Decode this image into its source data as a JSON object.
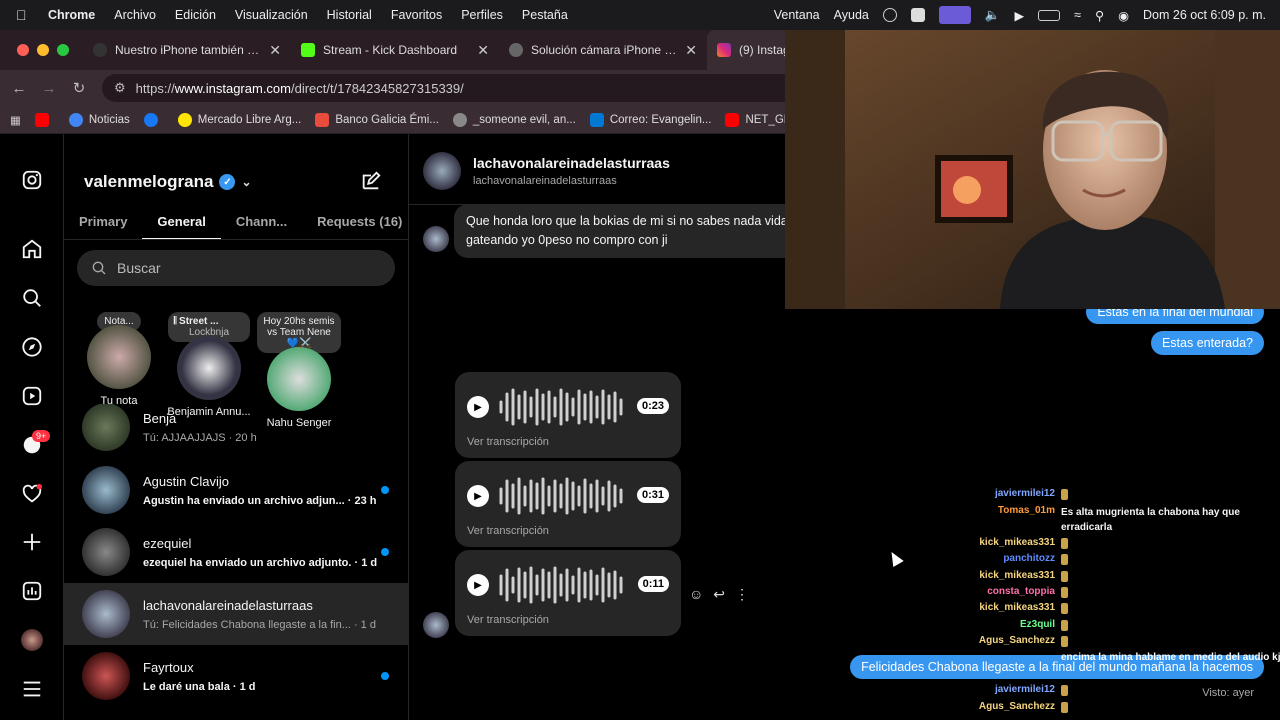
{
  "menubar": {
    "app": "Chrome",
    "items": [
      "Archivo",
      "Edición",
      "Visualización",
      "Historial",
      "Favoritos",
      "Perfiles",
      "Pestaña"
    ],
    "right_items": [
      "Ventana",
      "Ayuda"
    ],
    "datetime": "Dom 26 oct  6:09 p. m."
  },
  "tabs": [
    {
      "title": "Nuestro iPhone también será",
      "color": "#333333"
    },
    {
      "title": "Stream - Kick Dashboard",
      "color": "#53fc18"
    },
    {
      "title": "Solución cámara iPhone Mac",
      "color": "#555555"
    },
    {
      "title": "(9) Instagram",
      "color": "#e1306c"
    }
  ],
  "address": {
    "prefix": "https://",
    "host": "www.instagram.com",
    "path": "/direct/t/17842345827315339/"
  },
  "bookmarks": [
    {
      "label": "",
      "color": "#ff0000"
    },
    {
      "label": "Noticias",
      "color": "#4285f4"
    },
    {
      "label": "",
      "color": "#1877f2"
    },
    {
      "label": "Mercado Libre Arg...",
      "color": "#ffe600"
    },
    {
      "label": "Banco Galicia Émi...",
      "color": "#e74c3c"
    },
    {
      "label": "_someone evil, an...",
      "color": "#888888"
    },
    {
      "label": "Correo: Evangelin...",
      "color": "#0078d4"
    },
    {
      "label": "NET_GRA",
      "color": "#ff0000"
    }
  ],
  "inbox": {
    "account": "valenmelograna",
    "tabs": [
      "Primary",
      "General",
      "Chann...",
      "Requests (16)"
    ],
    "search_placeholder": "Buscar",
    "notes": [
      {
        "bubble": "Nota...",
        "caption": "Tu nota"
      },
      {
        "bubble": "Street ...",
        "bubble2": "Lockbnja",
        "caption": "Benjamin Annu..."
      },
      {
        "bubble": "Hoy 20hs semis vs Team Nene💙⚔️",
        "caption": "Nahu Senger"
      }
    ],
    "partial_row": {
      "name": "Benja",
      "preview": "Tú: AJJAAJJAJS · 20 h"
    },
    "threads": [
      {
        "name": "Agustin Clavijo",
        "preview": "Agustin ha enviado un archivo adjun... · 23 h",
        "unread": true
      },
      {
        "name": "ezequiel",
        "preview": "ezequiel ha enviado un archivo adjunto. · 1 d",
        "unread": true
      },
      {
        "name": "lachavonalareinadelasturraas",
        "preview": "Tú: Felicidades Chabona llegaste a la fin... · 1 d",
        "unread": false
      },
      {
        "name": "Fayrtoux",
        "preview": "Le daré una bala · 1 d",
        "unread": true
      }
    ],
    "badge": "9+"
  },
  "chat": {
    "name": "lachavonalareinadelasturraas",
    "username": "lachavonalareinadelasturraas",
    "incoming_text": "Que honda loro que la bokias  de mi si no sabes nada vida gato y seguí gateando yo 0peso no compro con ji",
    "voice_notes": [
      {
        "duration": "0:23",
        "transcript": "Ver transcripción"
      },
      {
        "duration": "0:31",
        "transcript": "Ver transcripción"
      },
      {
        "duration": "0:11",
        "transcript": "Ver transcripción"
      }
    ],
    "outgoing": [
      "Estas en la final del mundial",
      "Estas enterada?",
      "Felicidades Chabona llegaste a la final del mundo mañana la hacemos"
    ],
    "seen": "Visto: ayer"
  },
  "kick_chat": [
    {
      "user": "javiermilei12",
      "color": "#7fa7ff",
      "text": ""
    },
    {
      "user": "Tomas_01m",
      "color": "#ff9a3c",
      "text": "Es alta mugrienta la chabona hay que erradicarla"
    },
    {
      "user": "kick_mikeas331",
      "color": "#f5d580",
      "text": ""
    },
    {
      "user": "panchitozz",
      "color": "#5f8cff",
      "text": ""
    },
    {
      "user": "kick_mikeas331",
      "color": "#f5d580",
      "text": ""
    },
    {
      "user": "consta_toppia",
      "color": "#ff6fa8",
      "text": ""
    },
    {
      "user": "kick_mikeas331",
      "color": "#f5d580",
      "text": ""
    },
    {
      "user": "Ez3quil",
      "color": "#6dff8f",
      "text": ""
    },
    {
      "user": "Agus_Sanchezz",
      "color": "#f5d580",
      "text": ""
    },
    {
      "user": "",
      "color": "#ffffff",
      "text": "encima la mina hablame en medio del audio kjjj"
    },
    {
      "user": "javiermilei12",
      "color": "#7fa7ff",
      "text": ""
    },
    {
      "user": "Agus_Sanchezz",
      "color": "#f5d580",
      "text": ""
    }
  ]
}
